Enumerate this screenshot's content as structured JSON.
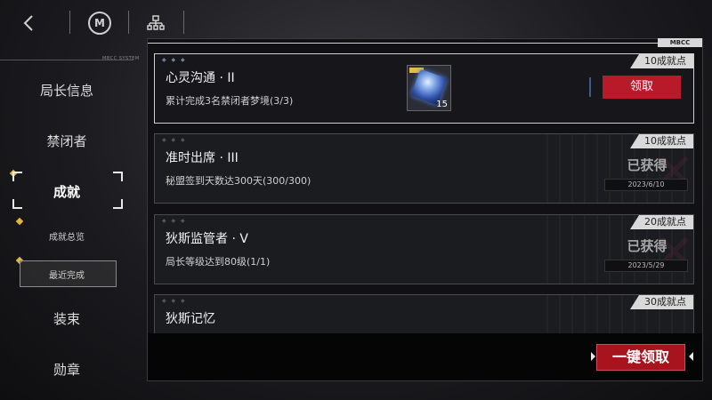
{
  "topbar": {
    "back_icon": "back-arrow-icon",
    "logo_letter": "M",
    "tree_icon": "hierarchy-icon"
  },
  "panel": {
    "tab_label": "MBCC"
  },
  "nav": {
    "header_text": "MBCC SYSTEM",
    "items": [
      {
        "label": "局长信息"
      },
      {
        "label": "禁闭者"
      },
      {
        "label": "成就"
      },
      {
        "label": "成就总览"
      },
      {
        "label": "最近完成"
      },
      {
        "label": "装束"
      },
      {
        "label": "勋章"
      }
    ]
  },
  "achievements": [
    {
      "title": "心灵沟通 · II",
      "desc": "累计完成3名禁闭者梦境(3/3)",
      "points": "10成就点",
      "action": "领取",
      "reward_count": "15"
    },
    {
      "title": "准时出席 · III",
      "desc": "秘盟签到天数达300天(300/300)",
      "points": "10成就点",
      "status": "已获得",
      "date": "2023/6/10"
    },
    {
      "title": "狄斯监管者 · V",
      "desc": "局长等级达到80级(1/1)",
      "points": "20成就点",
      "status": "已获得",
      "date": "2023/5/29"
    },
    {
      "title": "狄斯记忆",
      "points": "30成就点"
    }
  ],
  "claim_all_label": "一键领取",
  "colors": {
    "accent_red": "#b81a2a",
    "accent_gold": "#e2b940"
  }
}
